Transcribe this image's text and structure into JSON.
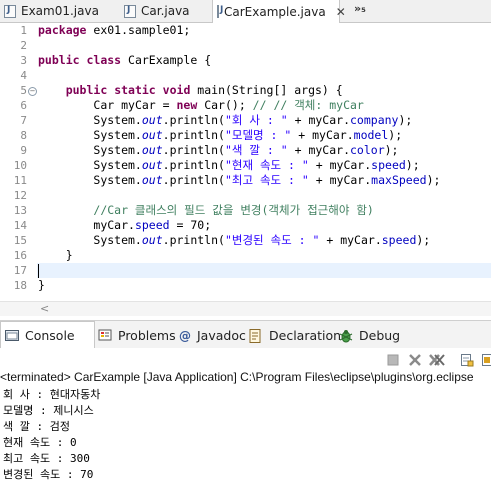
{
  "editor_tabs": [
    {
      "label": "Exam01.java",
      "active": false
    },
    {
      "label": "Car.java",
      "active": false
    },
    {
      "label": "CarExample.java",
      "active": true
    }
  ],
  "tab_overflow": "»₅",
  "close_glyph": "✕",
  "line_numbers": [
    "1",
    "2",
    "3",
    "4",
    "5",
    "6",
    "7",
    "8",
    "9",
    "10",
    "11",
    "12",
    "13",
    "14",
    "15",
    "16",
    "17",
    "18"
  ],
  "code": {
    "l1_kw": "package",
    "l1_rest": " ex01.sample01;",
    "l3_kw1": "public",
    "l3_kw2": "class",
    "l3_rest": " CarExample {",
    "l5_kw1": "public",
    "l5_kw2": "static",
    "l5_kw3": "void",
    "l5_rest": " main(String[] args) {",
    "l6_a": "Car ",
    "l6_var": "myCar",
    "l6_b": " = ",
    "l6_kw": "new",
    "l6_c": " Car(); ",
    "l6_cm": "// // 객체: myCar",
    "l7_a": "System.",
    "l7_out": "out",
    "l7_b": ".println(",
    "l7_str": "\"회 사 : \"",
    "l7_c": " + ",
    "l7_var": "myCar",
    "l7_d": ".",
    "l7_fld": "company",
    "l7_e": ");",
    "l8_a": "System.",
    "l8_out": "out",
    "l8_b": ".println(",
    "l8_str": "\"모델명 : \"",
    "l8_c": " + ",
    "l8_var": "myCar",
    "l8_d": ".",
    "l8_fld": "model",
    "l8_e": ");",
    "l9_a": "System.",
    "l9_out": "out",
    "l9_b": ".println(",
    "l9_str": "\"색 깔 : \"",
    "l9_c": " + ",
    "l9_var": "myCar",
    "l9_d": ".",
    "l9_fld": "color",
    "l9_e": ");",
    "l10_a": "System.",
    "l10_out": "out",
    "l10_b": ".println(",
    "l10_str": "\"현재 속도 : \"",
    "l10_c": " + ",
    "l10_var": "myCar",
    "l10_d": ".",
    "l10_fld": "speed",
    "l10_e": ");",
    "l11_a": "System.",
    "l11_out": "out",
    "l11_b": ".println(",
    "l11_str": "\"최고 속도 : \"",
    "l11_c": " + ",
    "l11_var": "myCar",
    "l11_d": ".",
    "l11_fld": "maxSpeed",
    "l11_e": ");",
    "l13_cm": "//Car 클래스의 필드 값을 변경(객체가 접근해야 함)",
    "l14_var": "myCar",
    "l14_d": ".",
    "l14_fld": "speed",
    "l14_e": " = 70;",
    "l15_a": "System.",
    "l15_out": "out",
    "l15_b": ".println(",
    "l15_str": "\"변경된 속도 : \"",
    "l15_c": " + ",
    "l15_var": "myCar",
    "l15_d": ".",
    "l15_fld": "speed",
    "l15_e": ");",
    "l16": "}",
    "l18": "}"
  },
  "fold_glyph": "−",
  "hscroll_arrow": "<",
  "view_tabs": [
    {
      "label": "Console",
      "active": true
    },
    {
      "label": "Problems",
      "active": false
    },
    {
      "label": "Javadoc",
      "active": false
    },
    {
      "label": "Declaration",
      "active": false
    },
    {
      "label": "Debug",
      "active": false
    }
  ],
  "console": {
    "terminated": "<terminated> CarExample [Java Application] C:\\Program Files\\eclipse\\plugins\\org.eclipse",
    "output": [
      "회 사 : 현대자동차",
      "모델명 : 제니시스",
      "색 깔 : 검정",
      "현재 속도 : 0",
      "최고 속도 : 300",
      "변경된 속도 : 70"
    ]
  },
  "colors": {
    "keyword": "#7f0055",
    "field": "#0000c0",
    "string": "#2a00ff",
    "comment": "#3f7f5f",
    "current_line": "#e8f2fe"
  }
}
